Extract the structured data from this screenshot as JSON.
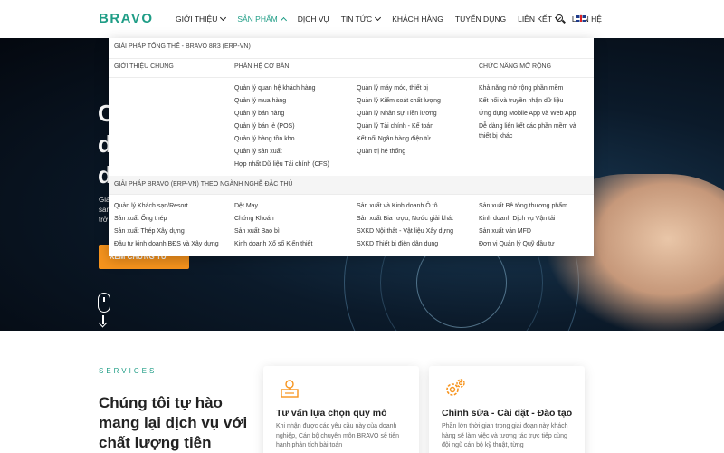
{
  "header": {
    "logo": "BRAVO",
    "nav": [
      {
        "label": "GIỚI THIỆU",
        "dropdown": true,
        "active": false
      },
      {
        "label": "SẢN PHẨM",
        "dropdown": true,
        "active": true
      },
      {
        "label": "DỊCH VỤ",
        "dropdown": false,
        "active": false
      },
      {
        "label": "TIN TỨC",
        "dropdown": true,
        "active": false
      },
      {
        "label": "KHÁCH HÀNG",
        "dropdown": false,
        "active": false
      },
      {
        "label": "TUYỂN DỤNG",
        "dropdown": false,
        "active": false
      },
      {
        "label": "LIÊN KẾT",
        "dropdown": true,
        "active": false
      },
      {
        "label": "LIÊN HỆ",
        "dropdown": false,
        "active": false
      }
    ],
    "icons": {
      "search": "search-icon",
      "language": "uk-flag-icon"
    },
    "accent_color": "#1f9d86"
  },
  "mega_menu": {
    "section1_title": "GIẢI PHÁP TỔNG THỂ - BRAVO 8R3 (ERP-VN)",
    "col_heads": [
      "GIỚI THIỆU CHUNG",
      "PHÂN HỆ CƠ BẢN",
      "CHỨC NĂNG MỞ RỘNG"
    ],
    "col2": [
      "Quản lý quan hệ khách hàng",
      "Quản lý mua hàng",
      "Quản lý bán hàng",
      "Quản lý bán lẻ (POS)",
      "Quản lý hàng tồn kho",
      "Quản lý sản xuất",
      "Hợp nhất Dữ liệu Tài chính (CFS)"
    ],
    "col3": [
      "Quản lý máy móc, thiết bị",
      "Quản lý Kiểm soát chất lượng",
      "Quản lý Nhân sự Tiền lương",
      "Quản lý Tài chính - Kế toán",
      "Kết nối Ngân hàng điện tử",
      "Quản trị hệ thống"
    ],
    "col4": [
      "Khả năng mở rộng phần mềm",
      "Kết nối và truyền nhận dữ liệu",
      "Ứng dụng Mobile App và Web App",
      "Dễ dàng liên kết các phần mềm và",
      "thiết bị khác"
    ],
    "section2_title": "GIẢI PHÁP BRAVO (ERP-VN) THEO NGÀNH NGHỀ ĐẶC THÙ",
    "ind_col1": [
      "Quản lý Khách sạn/Resort",
      "Sản xuất Ống thép",
      "Sản xuất Thép Xây dựng",
      "Đầu tư kinh doanh BĐS và Xây dựng"
    ],
    "ind_col2": [
      "Dệt May",
      "Chứng Khoán",
      "Sản xuất Bao bì",
      "Kinh doanh Xổ số Kiến thiết"
    ],
    "ind_col3": [
      "Sản xuất và Kinh doanh Ô tô",
      "Sản xuất Bia rượu, Nước giải khát",
      "SXKD Nội thất - Vật liệu Xây dựng",
      "SXKD Thiết bị điện dân dụng"
    ],
    "ind_col4": [
      "Sản xuất Bê tông thương phẩm",
      "Kinh doanh Dịch vụ Vận tải",
      "Sản xuất ván MFD",
      "Đơn vị Quản lý Quỹ đầu tư"
    ]
  },
  "hero": {
    "cta_label": "XEM CHỨNG TỪ",
    "button_color": "#f7941d"
  },
  "services": {
    "label": "SERVICES",
    "title": "Chúng tôi tự hào mang lại dịch vụ với chất lượng tiên phong",
    "cards": [
      {
        "title": "Tư vấn lựa chọn quy mô",
        "desc": "Khi nhận được các yêu cầu này của doanh nghiệp, Cán bộ chuyên môn BRAVO sẽ tiến hành phân tích bài toán",
        "icon": "consulting-icon"
      },
      {
        "title": "Chỉnh sửa - Cài đặt - Đào tạo",
        "desc": "Phần lớn thời gian trong giai đoạn này khách hàng sẽ làm việc và tương tác trực tiếp cùng đội ngũ cán bộ kỹ thuật, từng",
        "icon": "gears-icon"
      }
    ]
  }
}
